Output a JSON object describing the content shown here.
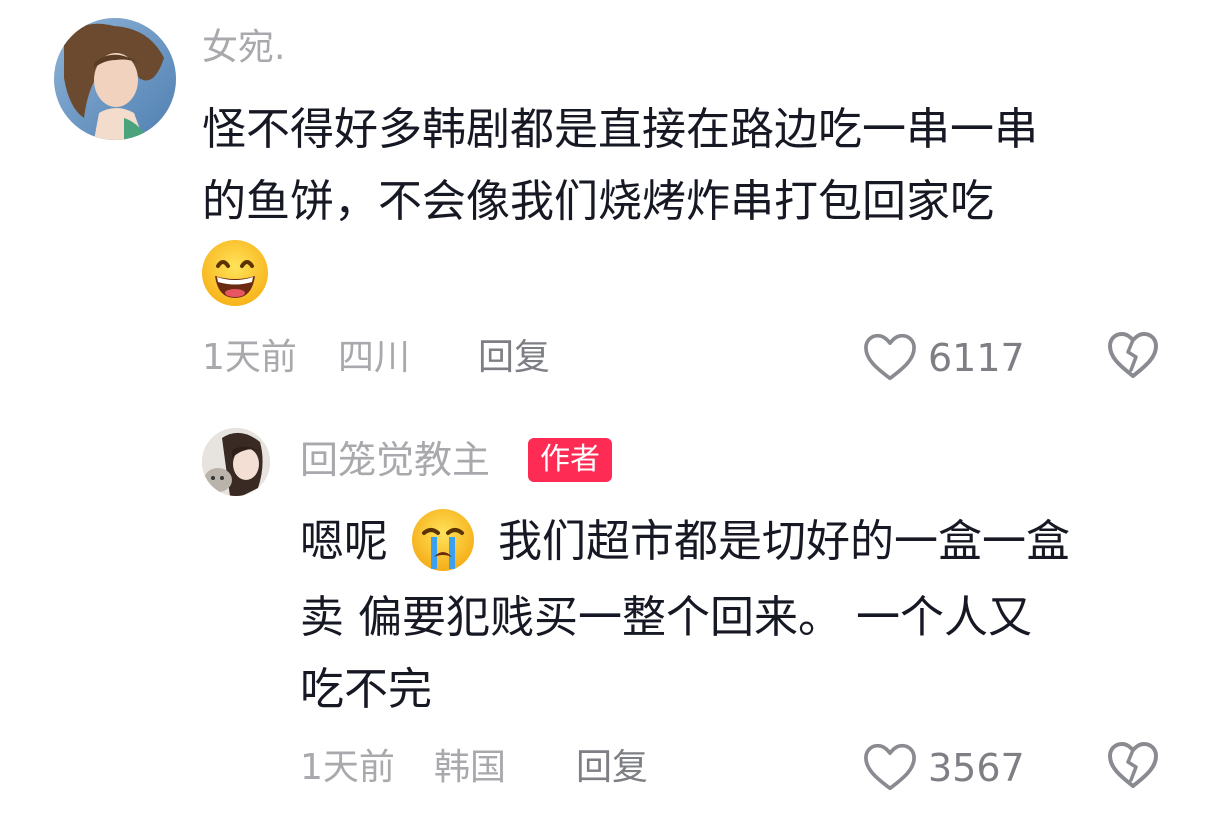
{
  "comments": [
    {
      "username": "女宛.",
      "text_line1": "怪不得好多韩剧都是直接在路边吃一串一串",
      "text_line2": "的鱼饼，不会像我们烧烤炸串打包回家吃",
      "emoji": "grinning-emoji",
      "time": "1天前",
      "location": "四川",
      "reply_label": "回复",
      "likes": "6117"
    }
  ],
  "replies": [
    {
      "username": "回笼觉教主",
      "badge": "作者",
      "text_prefix": "嗯呢",
      "emoji": "crying-emoji",
      "text_line1": "我们超市都是切好的一盒一盒",
      "text_line2": "卖 偏要犯贱买一整个回来。 一个人又",
      "text_line3": "吃不完",
      "time": "1天前",
      "location": "韩国",
      "reply_label": "回复",
      "likes": "3567"
    }
  ],
  "colors": {
    "username": "#a9a9ad",
    "meta": "#a9a9ad",
    "badge_bg": "#fe2c55",
    "text": "#161823"
  },
  "icons": {
    "like": "heart-outline-icon",
    "dislike": "broken-heart-icon"
  }
}
